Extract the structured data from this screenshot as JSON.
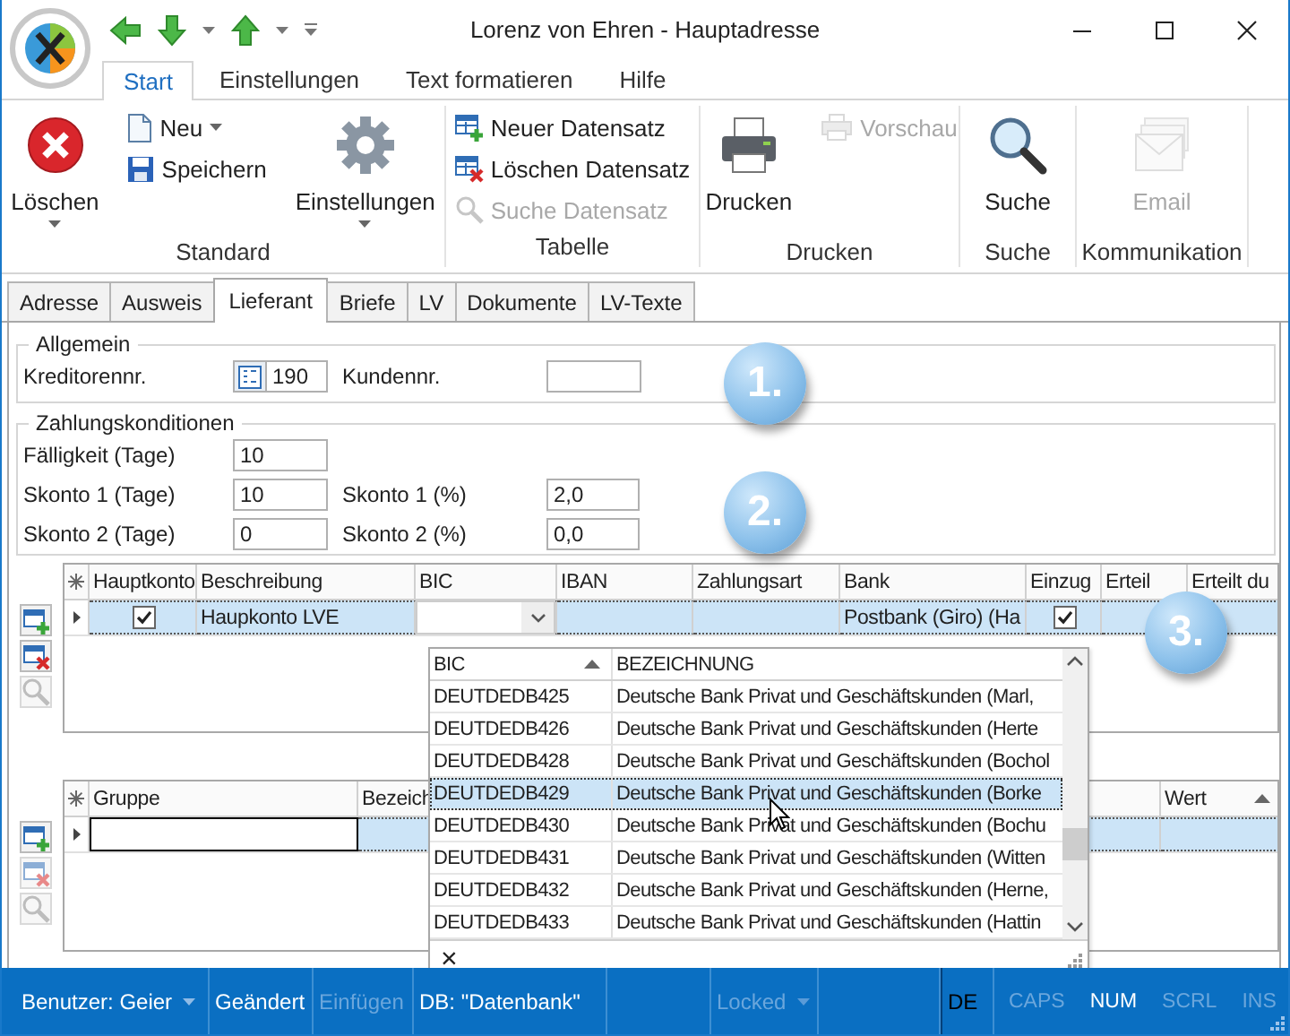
{
  "window": {
    "title": "Lorenz von Ehren - Hauptadresse"
  },
  "ribbon": {
    "tabs": [
      {
        "label": "Start",
        "selected": true
      },
      {
        "label": "Einstellungen",
        "selected": false
      },
      {
        "label": "Text formatieren",
        "selected": false
      },
      {
        "label": "Hilfe",
        "selected": false
      }
    ],
    "groups": [
      {
        "label": "Standard",
        "buttons": [
          {
            "kind": "large",
            "label": "Löschen",
            "menu": true,
            "disabled": false
          },
          {
            "kind": "small",
            "label": "Neu",
            "menu": true,
            "disabled": false
          },
          {
            "kind": "small",
            "label": "Speichern",
            "menu": false,
            "disabled": false
          },
          {
            "kind": "large",
            "label": "Einstellungen",
            "menu": true,
            "disabled": false
          }
        ]
      },
      {
        "label": "Tabelle",
        "buttons": [
          {
            "kind": "small",
            "label": "Neuer Datensatz",
            "menu": false,
            "disabled": false
          },
          {
            "kind": "small",
            "label": "Löschen Datensatz",
            "menu": false,
            "disabled": false
          },
          {
            "kind": "small",
            "label": "Suche Datensatz",
            "menu": false,
            "disabled": true
          }
        ]
      },
      {
        "label": "Drucken",
        "buttons": [
          {
            "kind": "large",
            "label": "Drucken",
            "menu": false,
            "disabled": false
          },
          {
            "kind": "small",
            "label": "Vorschau",
            "menu": false,
            "disabled": true
          }
        ]
      },
      {
        "label": "Suche",
        "buttons": [
          {
            "kind": "large",
            "label": "Suche",
            "menu": false,
            "disabled": false
          }
        ]
      },
      {
        "label": "Kommunikation",
        "buttons": [
          {
            "kind": "large",
            "label": "Email",
            "menu": false,
            "disabled": true
          }
        ]
      }
    ]
  },
  "tabs": [
    {
      "label": "Adresse",
      "selected": false
    },
    {
      "label": "Ausweis",
      "selected": false
    },
    {
      "label": "Lieferant",
      "selected": true
    },
    {
      "label": "Briefe",
      "selected": false
    },
    {
      "label": "LV",
      "selected": false
    },
    {
      "label": "Dokumente",
      "selected": false
    },
    {
      "label": "LV-Texte",
      "selected": false
    }
  ],
  "allgemein": {
    "legend": "Allgemein",
    "fields": [
      {
        "kind": "numbered",
        "label": "Kreditorennr.",
        "value": "190"
      },
      {
        "kind": "plain",
        "label": "Kundennr."
      }
    ]
  },
  "zahlungskonditionen": {
    "legend": "Zahlungskonditionen",
    "rows": [
      [
        {
          "label": "Fälligkeit (Tage)",
          "value": "10"
        }
      ],
      [
        {
          "label": "Skonto 1 (Tage)",
          "value": "10"
        },
        {
          "label": "Skonto 1 (%)",
          "value": "2,0"
        }
      ],
      [
        {
          "label": "Skonto 2 (Tage)",
          "value": "0"
        },
        {
          "label": "Skonto 2 (%)",
          "value": "0,0"
        }
      ]
    ]
  },
  "konten_grid": {
    "toolbar": [
      {
        "disabled": false
      },
      {
        "disabled": false
      },
      {
        "disabled": true
      }
    ],
    "columns": [
      {
        "label": "Hauptkonto"
      },
      {
        "label": "Beschreibung"
      },
      {
        "label": "BIC"
      },
      {
        "label": "IBAN"
      },
      {
        "label": "Zahlungsart"
      },
      {
        "label": "Bank"
      },
      {
        "label": "Einzug"
      },
      {
        "label": "Erteil"
      },
      {
        "label": "Erteilt du"
      }
    ],
    "rows": [
      {
        "selected": true,
        "cells": [
          {
            "kind": "check",
            "checked": true
          },
          {
            "kind": "text",
            "text": "Haupkonto LVE"
          },
          {
            "kind": "combo"
          },
          {
            "kind": "empty"
          },
          {
            "kind": "empty"
          },
          {
            "kind": "text",
            "text": "Postbank (Giro) (Ha"
          },
          {
            "kind": "check",
            "checked": true
          },
          {
            "kind": "empty"
          },
          {
            "kind": "empty"
          }
        ]
      }
    ]
  },
  "bic_dropdown": {
    "columns": [
      {
        "label": "BIC",
        "sort_ascending": true
      },
      {
        "label": "BEZEICHNUNG",
        "sort_ascending": false
      }
    ],
    "rows": [
      {
        "bic": "DEUTDEDB425",
        "name": "Deutsche Bank Privat und Geschäftskunden (Marl,",
        "selected": false
      },
      {
        "bic": "DEUTDEDB426",
        "name": "Deutsche Bank Privat und Geschäftskunden (Herte",
        "selected": false
      },
      {
        "bic": "DEUTDEDB428",
        "name": "Deutsche Bank Privat und Geschäftskunden (Bochol",
        "selected": false
      },
      {
        "bic": "DEUTDEDB429",
        "name": "Deutsche Bank Privat und Geschäftskunden (Borke",
        "selected": true
      },
      {
        "bic": "DEUTDEDB430",
        "name": "Deutsche Bank Privat und Geschäftskunden (Bochu",
        "selected": false
      },
      {
        "bic": "DEUTDEDB431",
        "name": "Deutsche Bank Privat und Geschäftskunden (Witten",
        "selected": false
      },
      {
        "bic": "DEUTDEDB432",
        "name": "Deutsche Bank Privat und Geschäftskunden (Herne,",
        "selected": false
      },
      {
        "bic": "DEUTDEDB433",
        "name": "Deutsche Bank Privat und Geschäftskunden (Hattin",
        "selected": false
      }
    ],
    "clear": "×"
  },
  "werte_grid": {
    "toolbar": [
      {
        "disabled": false
      },
      {
        "disabled": true
      },
      {
        "disabled": true
      }
    ],
    "columns": [
      {
        "label": "Gruppe",
        "sort_ascending": false
      },
      {
        "label": "Bezeich",
        "sort_ascending": false
      },
      {
        "label": "Wert",
        "sort_ascending": true
      }
    ],
    "rows": [
      {
        "selected": true
      }
    ]
  },
  "badges": [
    "1.",
    "2.",
    "3."
  ],
  "status_bar": {
    "items": [
      {
        "kind": "dropdown",
        "text": "Benutzer: Geier",
        "disabled": false
      },
      {
        "kind": "text",
        "text": "Geändert",
        "disabled": false
      },
      {
        "kind": "text",
        "text": "Einfügen",
        "disabled": true
      },
      {
        "kind": "text",
        "text": "DB: \"Datenbank\"",
        "disabled": false
      },
      {
        "kind": "blank"
      },
      {
        "kind": "dropdown",
        "text": "Locked",
        "disabled": true
      },
      {
        "kind": "blank"
      },
      {
        "kind": "lang",
        "text": "DE"
      }
    ],
    "keys": [
      {
        "label": "CAPS",
        "on": false
      },
      {
        "label": "NUM",
        "on": true
      },
      {
        "label": "SCRL",
        "on": false
      },
      {
        "label": "INS",
        "on": false
      }
    ]
  }
}
